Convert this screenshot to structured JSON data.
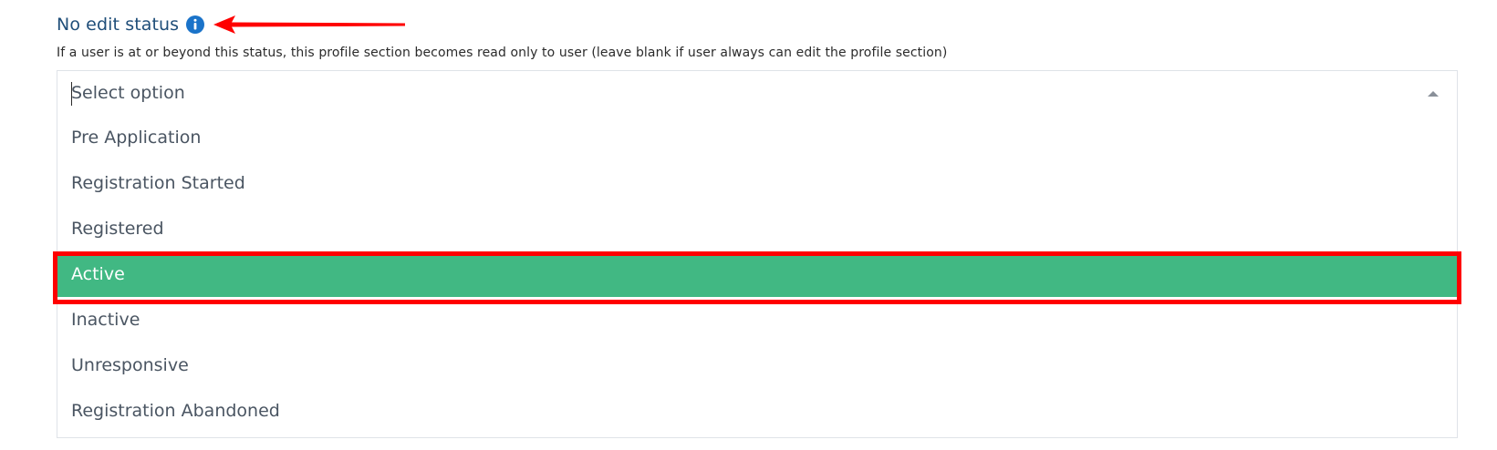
{
  "field": {
    "label": "No edit status",
    "help_text": "If a user is at or beyond this status, this profile section becomes read only to user (leave blank if user always can edit the profile section)",
    "icon": "info-icon"
  },
  "select": {
    "placeholder": "Select option",
    "open": true,
    "options": [
      {
        "label": "Pre Application"
      },
      {
        "label": "Registration Started"
      },
      {
        "label": "Registered"
      },
      {
        "label": "Active",
        "highlighted": true
      },
      {
        "label": "Inactive"
      },
      {
        "label": "Unresponsive"
      },
      {
        "label": "Registration Abandoned"
      }
    ]
  },
  "colors": {
    "label": "#1f4e79",
    "info_icon": "#1a73c9",
    "highlight": "#41b883",
    "annotation": "#ff0000"
  }
}
